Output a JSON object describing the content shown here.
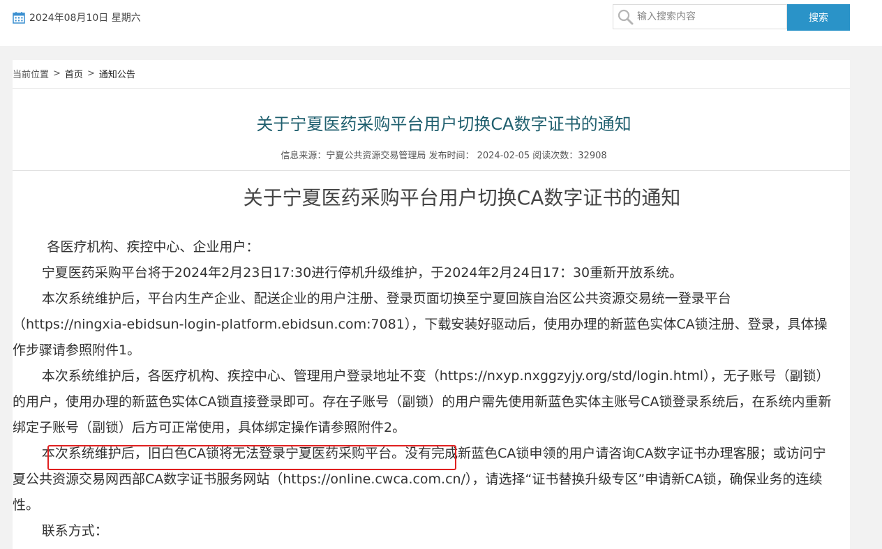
{
  "header": {
    "date": "2024年08月10日 星期六",
    "search": {
      "placeholder": "输入搜索内容",
      "button_label": "搜索"
    }
  },
  "breadcrumb": {
    "prefix": "当前位置",
    "separator": ">",
    "home": "首页",
    "current": "通知公告"
  },
  "article": {
    "title": "关于宁夏医药采购平台用户切换CA数字证书的通知",
    "meta": "信息来源：宁夏公共资源交易管理局 发布时间： 2024-02-05 阅读次数：32908",
    "content_title": "关于宁夏医药采购平台用户切换CA数字证书的通知",
    "paragraphs": [
      "各医疗机构、疾控中心、企业用户：",
      "宁夏医药采购平台将于2024年2月23日17:30进行停机升级维护，于2024年2月24日17：30重新开放系统。",
      "本次系统维护后，平台内生产企业、配送企业的用户注册、登录页面切换至宁夏回族自治区公共资源交易统一登录平台（https://ningxia-ebidsun-login-platform.ebidsun.com:7081），下载安装好驱动后，使用办理的新蓝色实体CA锁注册、登录，具体操作步骤请参照附件1。",
      "本次系统维护后，各医疗机构、疾控中心、管理用户登录地址不变（https://nxyp.nxggzyjy.org/std/login.html），无子账号（副锁）的用户，使用办理的新蓝色实体CA锁直接登录即可。存在子账号（副锁）的用户需先使用新蓝色实体主账号CA锁登录系统后，在系统内重新绑定子账号（副锁）后方可正常使用，具体绑定操作请参照附件2。",
      "本次系统维护后，旧白色CA锁将无法登录宁夏医药采购平台。没有完成新蓝色CA锁申领的用户请咨询CA数字证书办理客服；或访问宁夏公共资源交易网西部CA数字证书服务网站（https://online.cwca.com.cn/），请选择“证书替换升级专区”申请新CA锁，确保业务的连续性。",
      "联系方式："
    ]
  },
  "colors": {
    "accent": "#2a93c8",
    "title": "#1f5f6e",
    "highlight_box": "#e02020"
  }
}
